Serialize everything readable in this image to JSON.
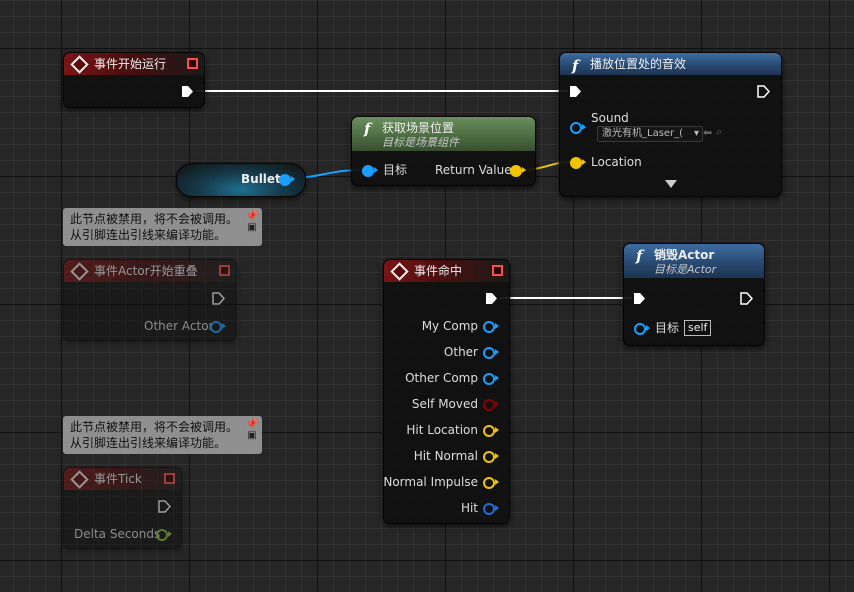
{
  "nodes": {
    "begin_play": {
      "title": "事件开始运行"
    },
    "play_sound": {
      "title": "播放位置处的音效",
      "pin_sound": "Sound",
      "sound_value": "激光有机_Laser_(",
      "pin_location": "Location"
    },
    "get_location": {
      "title": "获取场景位置",
      "subtitle": "目标是场景组件",
      "pin_target": "目标",
      "pin_return": "Return Value"
    },
    "bullet": {
      "label": "Bullet"
    },
    "overlap": {
      "title": "事件Actor开始重叠",
      "pin_other_actor": "Other Actor"
    },
    "hit": {
      "title": "事件命中",
      "pins": [
        "My Comp",
        "Other",
        "Other Comp",
        "Self Moved",
        "Hit Location",
        "Hit Normal",
        "Normal Impulse",
        "Hit"
      ]
    },
    "destroy": {
      "title": "销毁Actor",
      "subtitle": "目标是Actor",
      "pin_target": "目标",
      "self_value": "self"
    },
    "tick": {
      "title": "事件Tick",
      "pin_delta": "Delta Seconds"
    }
  },
  "comments": [
    {
      "line1": "此节点被禁用，将不会被调用。",
      "line2": "从引脚连出引线来编译功能。"
    },
    {
      "line1": "此节点被禁用，将不会被调用。",
      "line2": "从引脚连出引线来编译功能。"
    }
  ],
  "colors": {
    "exec": "#ffffff",
    "object": "#19a0ff",
    "vector": "#f2c400",
    "float": "#8fc23a",
    "bool": "#8a0000",
    "struct": "#1c6fdc",
    "event_header": "#7a1515",
    "function_header": "#3d6da0",
    "pure_header": "#6a8e5e"
  }
}
